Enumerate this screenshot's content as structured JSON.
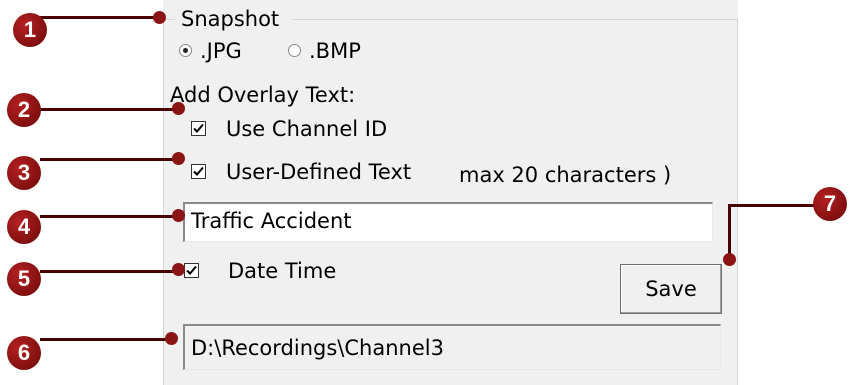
{
  "snapshot_group": {
    "title": "Snapshot",
    "format_options": [
      {
        "label": ".JPG",
        "selected": true
      },
      {
        "label": ".BMP",
        "selected": false
      }
    ],
    "overlay_label": "Add Overlay Text:",
    "use_channel_id": {
      "label": "Use Channel ID",
      "checked": true
    },
    "user_defined_text": {
      "label": "User-Defined Text",
      "hint": "max 20 characters )",
      "checked": true
    },
    "overlay_text_value": "Traffic Accident",
    "date_time": {
      "label": "Date Time",
      "checked": true
    },
    "save_label": "Save",
    "path_value": "D:\\Recordings\\Channel3"
  },
  "callouts": [
    "1",
    "2",
    "3",
    "4",
    "5",
    "6",
    "7"
  ],
  "colors": {
    "callout": "#8b1515",
    "panel_bg": "#f0f0f0"
  }
}
